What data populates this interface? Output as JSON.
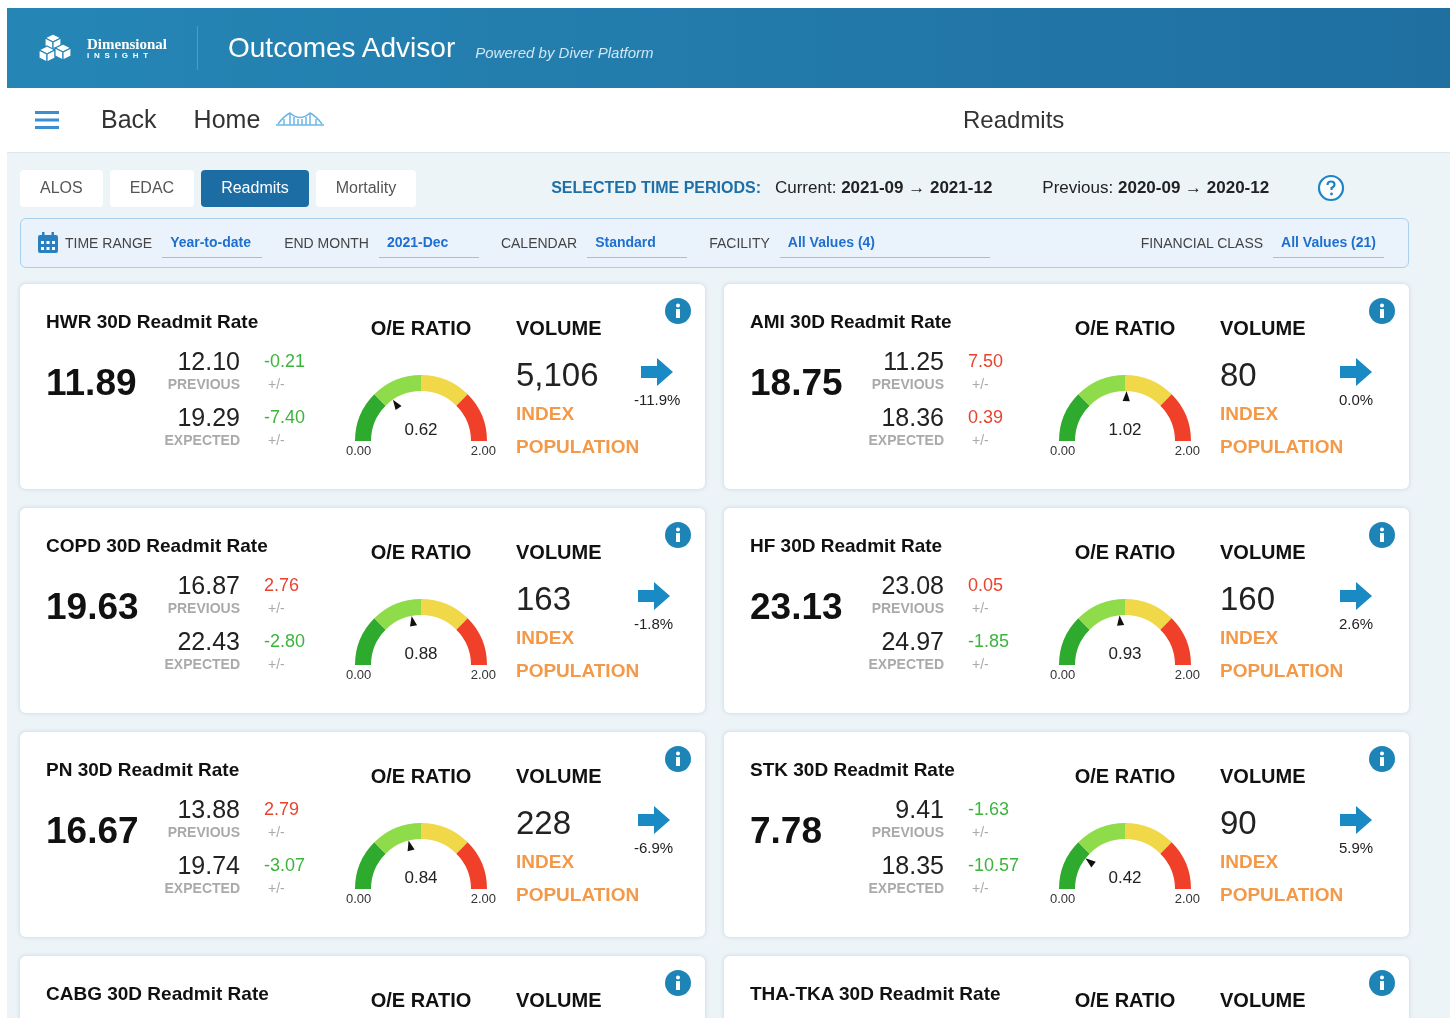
{
  "header": {
    "logo_lines": [
      "Dimensional",
      "INSIGHT"
    ],
    "app_title": "Outcomes Advisor",
    "powered_by": "Powered by Diver Platform"
  },
  "nav": {
    "back": "Back",
    "home": "Home",
    "page_title": "Readmits"
  },
  "tabs": [
    {
      "label": "ALOS",
      "selected": false
    },
    {
      "label": "EDAC",
      "selected": false
    },
    {
      "label": "Readmits",
      "selected": true
    },
    {
      "label": "Mortality",
      "selected": false
    }
  ],
  "periods": {
    "label": "SELECTED TIME PERIODS:",
    "current_label": "Current:",
    "current_value": "2021-09 → 2021-12",
    "previous_label": "Previous:",
    "previous_value": "2020-09 → 2020-12"
  },
  "filters": [
    {
      "label": "TIME RANGE",
      "value": "Year-to-date"
    },
    {
      "label": "END MONTH",
      "value": "2021-Dec"
    },
    {
      "label": "CALENDAR",
      "value": "Standard"
    },
    {
      "label": "FACILITY",
      "value": "All Values (4)"
    },
    {
      "label": "FINANCIAL CLASS",
      "value": "All Values (21)"
    }
  ],
  "cards": [
    {
      "title": "HWR 30D Readmit Rate",
      "value": "11.89",
      "previous": {
        "value": "12.10",
        "label": "PREVIOUS",
        "delta": "-0.21",
        "delta_label": "+/-",
        "good": true
      },
      "expected": {
        "value": "19.29",
        "label": "EXPECTED",
        "delta": "-7.40",
        "delta_label": "+/-",
        "good": true
      },
      "ratio_label": "O/E RATIO",
      "ratio": "0.62",
      "level": 0.31,
      "min": "0.00",
      "max": "2.00",
      "volume_label": "VOLUME",
      "volume": "5,106",
      "change": "-11.9%",
      "index_lines": [
        "INDEX",
        "POPULATION"
      ]
    },
    {
      "title": "AMI 30D Readmit Rate",
      "value": "18.75",
      "previous": {
        "value": "11.25",
        "label": "PREVIOUS",
        "delta": "7.50",
        "delta_label": "+/-",
        "good": false
      },
      "expected": {
        "value": "18.36",
        "label": "EXPECTED",
        "delta": "0.39",
        "delta_label": "+/-",
        "good": false
      },
      "ratio_label": "O/E RATIO",
      "ratio": "1.02",
      "level": 0.51,
      "min": "0.00",
      "max": "2.00",
      "volume_label": "VOLUME",
      "volume": "80",
      "change": "0.0%",
      "index_lines": [
        "INDEX",
        "POPULATION"
      ]
    },
    {
      "title": "COPD 30D Readmit Rate",
      "value": "19.63",
      "previous": {
        "value": "16.87",
        "label": "PREVIOUS",
        "delta": "2.76",
        "delta_label": "+/-",
        "good": false
      },
      "expected": {
        "value": "22.43",
        "label": "EXPECTED",
        "delta": "-2.80",
        "delta_label": "+/-",
        "good": true
      },
      "ratio_label": "O/E RATIO",
      "ratio": "0.88",
      "level": 0.44,
      "min": "0.00",
      "max": "2.00",
      "volume_label": "VOLUME",
      "volume": "163",
      "change": "-1.8%",
      "index_lines": [
        "INDEX",
        "POPULATION"
      ]
    },
    {
      "title": "HF 30D Readmit Rate",
      "value": "23.13",
      "previous": {
        "value": "23.08",
        "label": "PREVIOUS",
        "delta": "0.05",
        "delta_label": "+/-",
        "good": false
      },
      "expected": {
        "value": "24.97",
        "label": "EXPECTED",
        "delta": "-1.85",
        "delta_label": "+/-",
        "good": true
      },
      "ratio_label": "O/E RATIO",
      "ratio": "0.93",
      "level": 0.465,
      "min": "0.00",
      "max": "2.00",
      "volume_label": "VOLUME",
      "volume": "160",
      "change": "2.6%",
      "index_lines": [
        "INDEX",
        "POPULATION"
      ]
    },
    {
      "title": "PN 30D Readmit Rate",
      "value": "16.67",
      "previous": {
        "value": "13.88",
        "label": "PREVIOUS",
        "delta": "2.79",
        "delta_label": "+/-",
        "good": false
      },
      "expected": {
        "value": "19.74",
        "label": "EXPECTED",
        "delta": "-3.07",
        "delta_label": "+/-",
        "good": true
      },
      "ratio_label": "O/E RATIO",
      "ratio": "0.84",
      "level": 0.42,
      "min": "0.00",
      "max": "2.00",
      "volume_label": "VOLUME",
      "volume": "228",
      "change": "-6.9%",
      "index_lines": [
        "INDEX",
        "POPULATION"
      ]
    },
    {
      "title": "STK 30D Readmit Rate",
      "value": "7.78",
      "previous": {
        "value": "9.41",
        "label": "PREVIOUS",
        "delta": "-1.63",
        "delta_label": "+/-",
        "good": true
      },
      "expected": {
        "value": "18.35",
        "label": "EXPECTED",
        "delta": "-10.57",
        "delta_label": "+/-",
        "good": true
      },
      "ratio_label": "O/E RATIO",
      "ratio": "0.42",
      "level": 0.21,
      "min": "0.00",
      "max": "2.00",
      "volume_label": "VOLUME",
      "volume": "90",
      "change": "5.9%",
      "index_lines": [
        "INDEX",
        "POPULATION"
      ]
    },
    {
      "title": "CABG 30D Readmit Rate",
      "ratio_label": "O/E RATIO",
      "volume_label": "VOLUME"
    },
    {
      "title": "THA-TKA 30D Readmit Rate",
      "ratio_label": "O/E RATIO",
      "volume_label": "VOLUME"
    }
  ]
}
